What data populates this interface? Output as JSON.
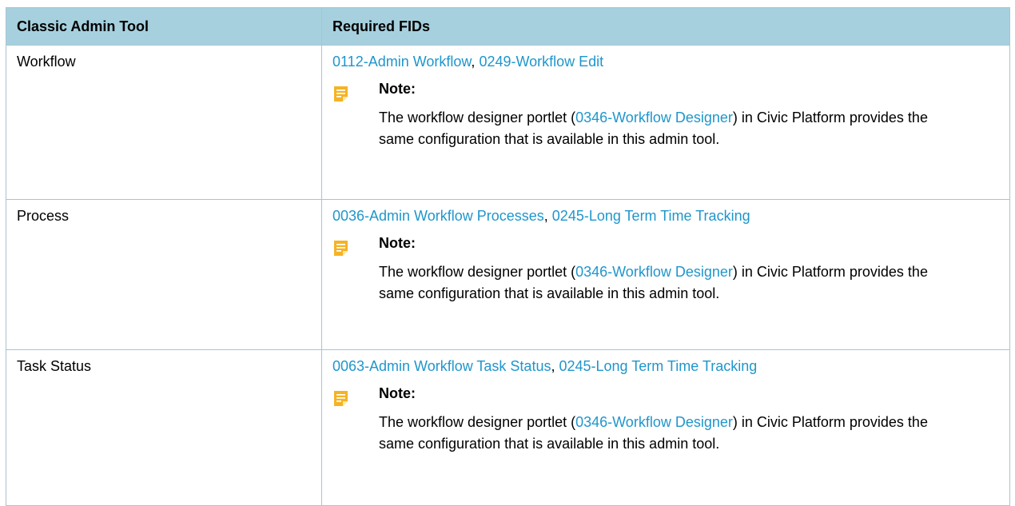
{
  "table": {
    "headers": [
      "Classic Admin Tool",
      "Required FIDs"
    ],
    "rows": [
      {
        "tool": "Workflow",
        "fids": [
          "0112-Admin Workflow",
          "0249-Workflow Edit"
        ],
        "fid_separator": ", ",
        "note": {
          "label": "Note:",
          "text_before": "The workflow designer portlet (",
          "link": "0346-Workflow Designer",
          "text_after": ") in Civic Platform provides the same configuration that is available in this admin tool."
        }
      },
      {
        "tool": "Process",
        "fids": [
          "0036-Admin Workflow Processes",
          "0245-Long Term Time Tracking"
        ],
        "fid_separator": ", ",
        "note": {
          "label": "Note:",
          "text_before": "The workflow designer portlet (",
          "link": "0346-Workflow Designer",
          "text_after": ") in Civic Platform provides the same configuration that is available in this admin tool."
        }
      },
      {
        "tool": "Task Status",
        "fids": [
          "0063-Admin Workflow Task Status",
          "0245-Long Term Time Tracking"
        ],
        "fid_separator": ", ",
        "note": {
          "label": "Note:",
          "text_before": "The workflow designer portlet (",
          "link": "0346-Workflow Designer",
          "text_after": ") in Civic Platform provides the same configuration that is available in this admin tool."
        }
      }
    ]
  },
  "icons": {
    "note": "note-icon"
  },
  "colors": {
    "header_background": "#a6d0de",
    "link": "#1f96cc",
    "border": "#a8c4d2",
    "note_icon": "#f5b324"
  }
}
